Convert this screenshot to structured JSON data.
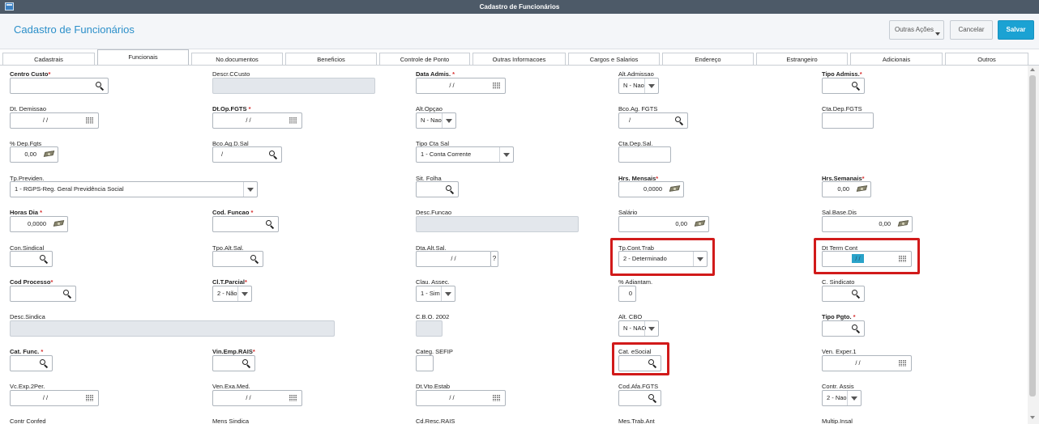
{
  "window": {
    "title": "Cadastro de Funcionários"
  },
  "header": {
    "title": "Cadastro de Funcionários",
    "buttons": {
      "outras_acoes": "Outras Ações",
      "cancelar": "Cancelar",
      "salvar": "Salvar"
    }
  },
  "tabs": [
    "Cadastrais",
    "Funcionais",
    "No.documentos",
    "Beneficios",
    "Controle de Ponto",
    "Outras Informacoes",
    "Cargos e Salarios",
    "Endereço",
    "Estrangeiro",
    "Adicionais",
    "Outros"
  ],
  "active_tab": "Funcionais",
  "fields": {
    "centro_custo": {
      "label": "Centro Custo",
      "required": "*",
      "value": ""
    },
    "descr_ccusto": {
      "label": "Descr.CCusto",
      "value": ""
    },
    "data_admis": {
      "label": "Data Admis.",
      "required": "*",
      "value": "/ /"
    },
    "alt_admissao": {
      "label": "Alt.Admissao",
      "value": "N - Nao"
    },
    "tipo_admiss": {
      "label": "Tipo Admiss.",
      "required": "*",
      "value": ""
    },
    "dt_demissao": {
      "label": "Dt. Demissao",
      "value": "/ /"
    },
    "dt_op_fgts": {
      "label": "Dt.Op.FGTS",
      "required": "*",
      "value": "/ /"
    },
    "alt_opcao": {
      "label": "Alt.Opçao",
      "value": "N - Nao"
    },
    "bco_ag_fgts": {
      "label": "Bco.Ag. FGTS",
      "value": "/"
    },
    "cta_dep_fgts": {
      "label": "Cta.Dep.FGTS",
      "value": ""
    },
    "pct_dep_fgts": {
      "label": "% Dep.Fgts",
      "value": "0,00"
    },
    "bco_ag_d_sal": {
      "label": "Bco.Ag.D.Sal",
      "value": "/"
    },
    "tipo_cta_sal": {
      "label": "Tipo Cta Sal",
      "value": "1 - Conta Corrente"
    },
    "cta_dep_sal": {
      "label": "Cta.Dep.Sal.",
      "value": ""
    },
    "tp_previden": {
      "label": "Tp.Previden.",
      "value": "1 - RGPS-Reg. Geral Previdência Social"
    },
    "sit_folha": {
      "label": "Sit. Folha",
      "value": ""
    },
    "hrs_mensais": {
      "label": "Hrs. Mensais",
      "required": "*",
      "value": "0,0000"
    },
    "hrs_semanais": {
      "label": "Hrs.Semanais",
      "required": "*",
      "value": "0,00"
    },
    "horas_dia": {
      "label": "Horas Dia",
      "required": "*",
      "value": "0,0000"
    },
    "cod_funcao": {
      "label": "Cod. Funcao",
      "required": "*",
      "value": ""
    },
    "desc_funcao": {
      "label": "Desc.Funcao",
      "value": ""
    },
    "salario": {
      "label": "Salário",
      "value": "0,00"
    },
    "sal_base_dis": {
      "label": "Sal.Base.Dis",
      "value": "0,00"
    },
    "con_sindical": {
      "label": "Con.Sindical",
      "value": ""
    },
    "tpo_alt_sal": {
      "label": "Tpo.Alt.Sal.",
      "value": ""
    },
    "dta_alt_sal": {
      "label": "Dta.Alt.Sal.",
      "value": "/ /"
    },
    "dta_alt_sal_help": "?",
    "tp_cont_trab": {
      "label": "Tp.Cont.Trab",
      "value": "2 - Determinado"
    },
    "dt_term_cont": {
      "label": "Dt Term Cont",
      "value": "/ /"
    },
    "cod_processo": {
      "label": "Cod Processo",
      "required": "*",
      "value": ""
    },
    "clt_parcial": {
      "label": "Cl.T.Parcial",
      "required": "*",
      "value": "2 - Não"
    },
    "clau_assec": {
      "label": "Clau. Assec.",
      "value": "1 - Sim"
    },
    "pct_adiantam": {
      "label": "% Adiantam.",
      "value": "0"
    },
    "c_sindicato": {
      "label": "C. Sindicato",
      "value": ""
    },
    "desc_sindica": {
      "label": "Desc.Sindica",
      "value": ""
    },
    "cbo_2002": {
      "label": "C.B.O. 2002",
      "value": ""
    },
    "alt_cbo": {
      "label": "Alt. CBO",
      "value": "N - NAO"
    },
    "tipo_pgto": {
      "label": "Tipo Pgto.",
      "required": "*",
      "value": ""
    },
    "cat_func": {
      "label": "Cat. Func.",
      "required": "*",
      "value": ""
    },
    "vin_emp_rais": {
      "label": "Vin.Emp.RAIS",
      "required": "*",
      "value": ""
    },
    "categ_sefip": {
      "label": "Categ. SEFIP",
      "value": ""
    },
    "cat_esocial": {
      "label": "Cat. eSocial",
      "value": ""
    },
    "ven_exper_1": {
      "label": "Ven. Exper.1",
      "value": "/ /"
    },
    "vc_exp_2per": {
      "label": "Vc.Exp.2Per.",
      "value": "/ /"
    },
    "ven_exa_med": {
      "label": "Ven.Exa.Med.",
      "value": "/ /"
    },
    "dt_vto_estab": {
      "label": "Dt.Vto.Estab",
      "value": "/ /"
    },
    "cod_afa_fgts": {
      "label": "Cod.Afa.FGTS",
      "value": ""
    },
    "contr_assis": {
      "label": "Contr. Assis",
      "value": "2 - Nao"
    },
    "contr_confed": {
      "label": "Contr Confed"
    },
    "mens_sindica": {
      "label": "Mens Sindica"
    },
    "cd_resc_rais": {
      "label": "Cd.Resc.RAIS"
    },
    "mes_trab_ant": {
      "label": "Mes.Trab.Ant"
    },
    "multip_insal": {
      "label": "Multip.Insal"
    }
  },
  "colors": {
    "accent": "#1ba2d3",
    "title": "#2b8fc9",
    "highlight_border": "#d11a1a",
    "titlebar": "#4d5a68"
  }
}
